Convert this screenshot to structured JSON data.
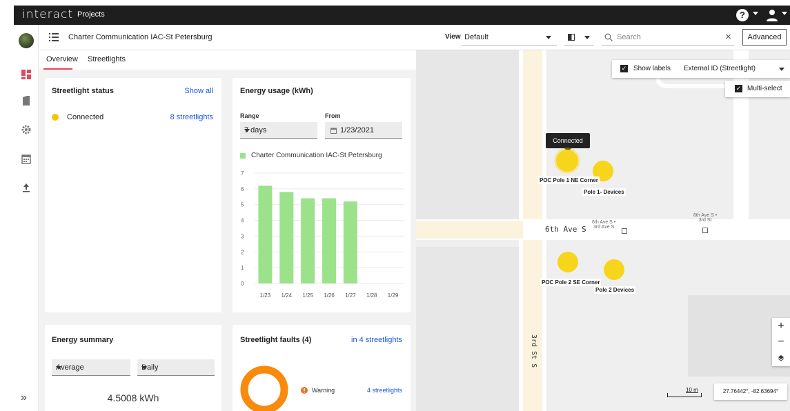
{
  "topbar": {
    "brand": "interact",
    "app_name": "Projects",
    "help_label": "?"
  },
  "header": {
    "project_title": "Charter Communication IAC-St Petersburg",
    "view_label": "View",
    "view_value": "Default",
    "search_placeholder": "Search",
    "search_clear": "×",
    "advanced_label": "Advanced"
  },
  "tabs": [
    {
      "label": "Overview",
      "active": true
    },
    {
      "label": "Streetlights",
      "active": false
    }
  ],
  "streetlight_status": {
    "title": "Streetlight status",
    "show_all": "Show all",
    "status_label": "Connected",
    "status_count": "8 streetlights",
    "status_color": "#f5c400"
  },
  "energy_usage": {
    "title": "Energy usage (kWh)",
    "range_label": "Range",
    "range_value": "7 days",
    "from_label": "From",
    "from_value": "1/23/2021",
    "legend": "Charter Communication IAC-St Petersburg",
    "bar_color": "#9be28a"
  },
  "chart_data": {
    "type": "bar",
    "categories": [
      "1/23",
      "1/24",
      "1/25",
      "1/26",
      "1/27",
      "1/28",
      "1/29"
    ],
    "series": [
      {
        "name": "Charter Communication IAC-St Petersburg",
        "values": [
          6.2,
          5.8,
          5.4,
          5.4,
          5.2,
          0,
          0
        ]
      }
    ],
    "yticks": [
      "0",
      "1",
      "2",
      "3",
      "4",
      "5",
      "6",
      "7"
    ],
    "ylim": [
      0,
      7
    ],
    "grid": true,
    "legend_position": "top"
  },
  "energy_summary": {
    "title": "Energy summary",
    "aggregate_value": "Average",
    "period_value": "Daily",
    "total": "4.5008 kWh"
  },
  "faults": {
    "title": "Streetlight faults (4)",
    "link": "in 4 streetlights",
    "item_label": "Warning",
    "item_count": "4 streetlights",
    "ring_color": "#f98a0b",
    "warning_color": "#e8742a"
  },
  "map": {
    "show_labels": "Show labels",
    "label_select": "External ID (Streetlight)",
    "multi_select": "Multi-select",
    "tooltip": "Connected",
    "poles": [
      {
        "label": "POC Pole 1 NE Corner"
      },
      {
        "label": "Pole 1- Devices"
      },
      {
        "label": "POC Pole 2 SE Corner"
      },
      {
        "label": "Pole 2 Devices"
      }
    ],
    "street_6th": "6th Ave S",
    "stop_1": "6th Ave S •",
    "stop_1b": "3rd Ave S",
    "stop_2": "6th Ave S •",
    "stop_2b": "3rd St",
    "street_3rd": "3rd St S",
    "zoom_in": "+",
    "zoom_out": "−",
    "scale_label": "10 m",
    "coordinates": "27.76442°, -82.63694°",
    "pole_color": "#f8d51d"
  }
}
